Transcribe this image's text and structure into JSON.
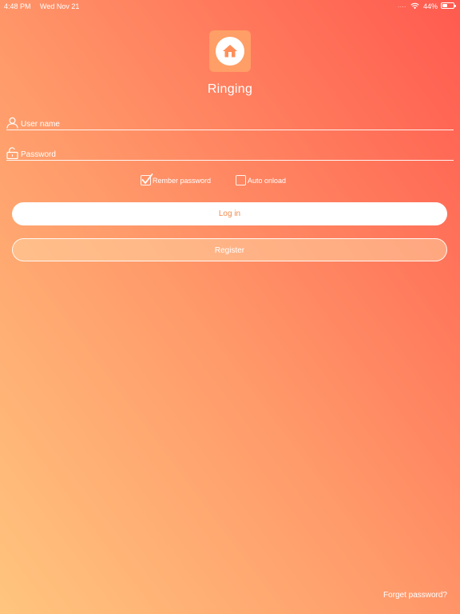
{
  "status_bar": {
    "time": "4:48 PM",
    "date": "Wed Nov 21",
    "signal_dots": "....",
    "battery_percent": "44%",
    "battery_level": 0.44,
    "icons": [
      "wifi-icon",
      "battery-icon"
    ]
  },
  "app": {
    "title": "Ringing",
    "logo_icon": "home-icon"
  },
  "login_form": {
    "username": {
      "value": "",
      "placeholder": "User name",
      "icon": "user-icon"
    },
    "password": {
      "value": "",
      "placeholder": "Password",
      "icon": "lock-icon"
    },
    "remember": {
      "label": "Rember password",
      "checked": true
    },
    "auto_onload": {
      "label": "Auto onload",
      "checked": false
    },
    "login_label": "Log in",
    "register_label": "Register",
    "forgot_label": "Forget password?"
  },
  "colors": {
    "gradient_top": "#ff5a4f",
    "gradient_bottom": "#ffc57e",
    "accent": "#f08a4b",
    "logo_bg": "#ff9e66"
  }
}
